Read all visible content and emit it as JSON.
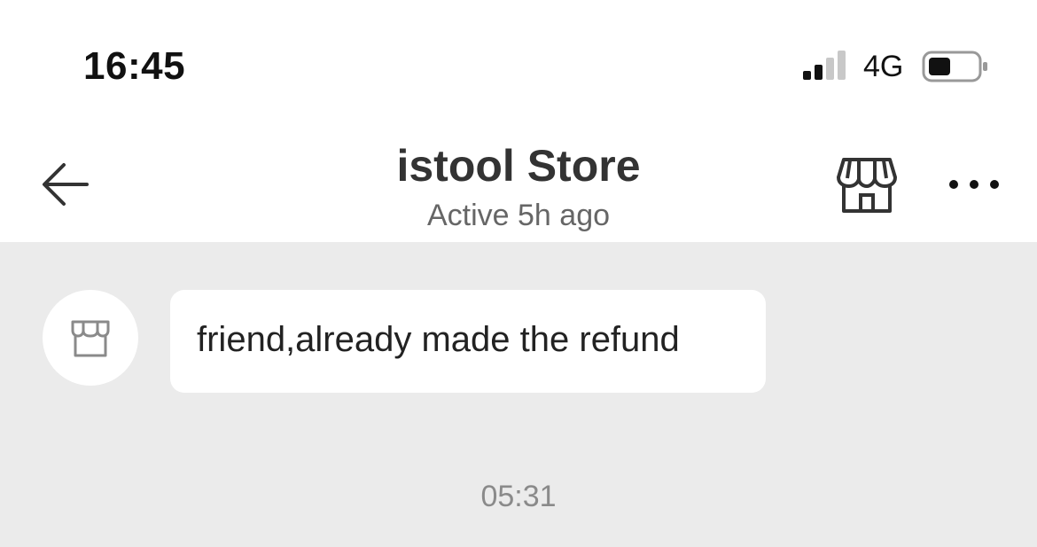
{
  "status_bar": {
    "time": "16:45",
    "network": "4G",
    "icons": [
      "signal-bars-icon",
      "battery-icon"
    ]
  },
  "header": {
    "title": "istool Store",
    "subtitle": "Active 5h ago",
    "icons": [
      "back-arrow-icon",
      "storefront-icon",
      "more-dots-icon"
    ]
  },
  "chat": {
    "background": "#ebebeb",
    "messages": [
      {
        "sender_avatar": "storefront-icon",
        "text": "friend,already made the refund"
      }
    ],
    "timestamp": "05:31"
  }
}
